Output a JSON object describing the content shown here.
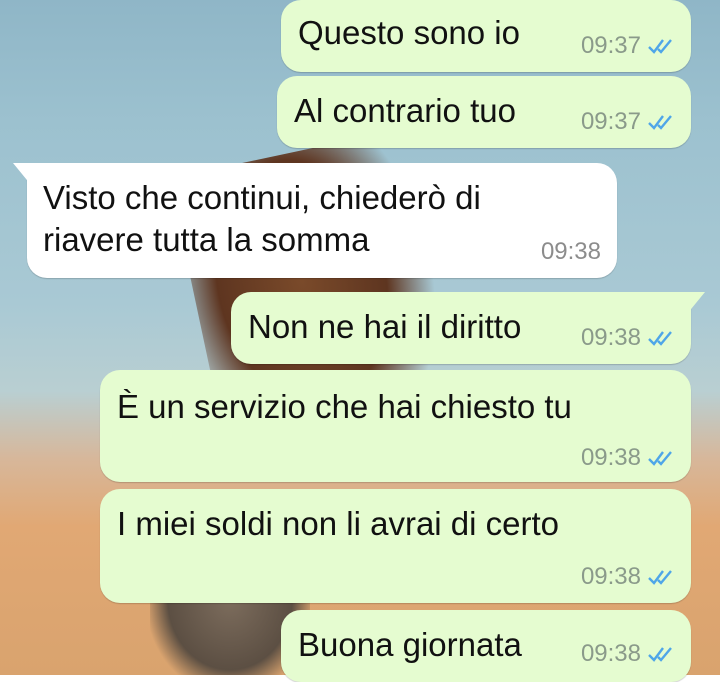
{
  "messages": [
    {
      "text": "Questo sono io",
      "time": "09:37",
      "direction": "outgoing",
      "status": "read"
    },
    {
      "text": "Al contrario tuo",
      "time": "09:37",
      "direction": "outgoing",
      "status": "read"
    },
    {
      "text_line1": "Visto che continui, chiederò di",
      "text_line2": "riavere tutta la somma",
      "time": "09:38",
      "direction": "incoming"
    },
    {
      "text": "Non ne hai il diritto",
      "time": "09:38",
      "direction": "outgoing",
      "status": "read"
    },
    {
      "text": "È un servizio che hai chiesto tu",
      "time": "09:38",
      "direction": "outgoing",
      "status": "read"
    },
    {
      "text": "I miei soldi non li avrai di certo",
      "time": "09:38",
      "direction": "outgoing",
      "status": "read"
    },
    {
      "text": "Buona giornata",
      "time": "09:38",
      "direction": "outgoing",
      "status": "read"
    }
  ],
  "colors": {
    "outgoing_bubble": "#e5fcd0",
    "incoming_bubble": "#ffffff",
    "read_ticks": "#4fa6e8"
  },
  "icons": {
    "read_receipt": "double-check-icon"
  }
}
